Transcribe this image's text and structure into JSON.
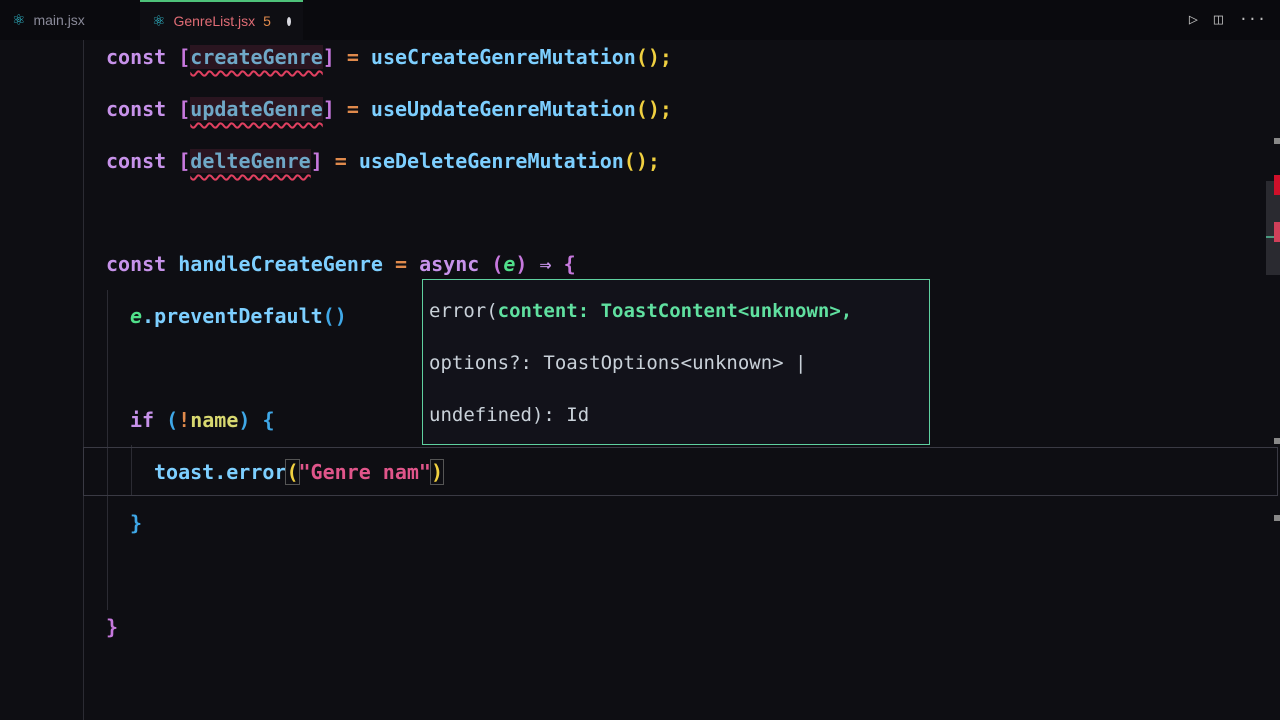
{
  "tabs": [
    {
      "label": "main.jsx"
    },
    {
      "label": "GenreList.jsx",
      "problems": "5"
    }
  ],
  "code": {
    "l1": [
      "const ",
      "[",
      "createGenre",
      "]",
      " = ",
      "useCreateGenreMutation",
      "();"
    ],
    "l2": [
      "const ",
      "[",
      "updateGenre",
      "]",
      " = ",
      "useUpdateGenreMutation",
      "();"
    ],
    "l3": [
      "const ",
      "[",
      "delteGenre",
      "]",
      " = ",
      "useDeleteGenreMutation",
      "();"
    ],
    "l4": [
      "const ",
      "handleCreateGenre",
      " = ",
      "async ",
      "(",
      "e",
      ")",
      " ⇒ ",
      "{"
    ],
    "l5": [
      "e",
      ".preventDefault",
      "()"
    ],
    "l6": [
      "if ",
      "(",
      "!",
      "name",
      ") ",
      "{"
    ],
    "l7": [
      "toast.error",
      "(",
      "\"Genre nam\"",
      ")"
    ],
    "l8": "}",
    "l9": "}"
  },
  "tooltip": {
    "a": "error(",
    "b": "content: ToastContent<unknown>,",
    "c": "options?: ToastOptions<unknown> |",
    "d": "undefined): Id"
  }
}
